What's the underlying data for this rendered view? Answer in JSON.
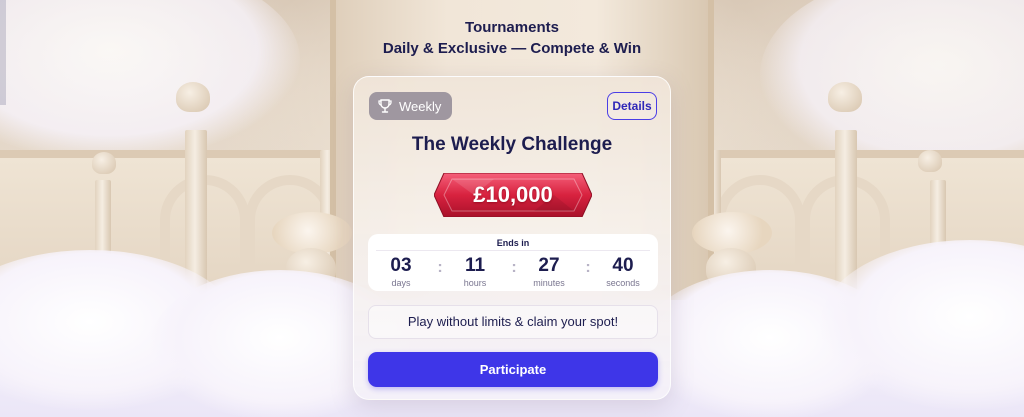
{
  "header": {
    "title": "Tournaments",
    "subtitle": "Daily & Exclusive — Compete & Win"
  },
  "card": {
    "badge": {
      "icon": "trophy-icon",
      "label": "Weekly"
    },
    "details_label": "Details",
    "title": "The Weekly Challenge",
    "prize": "£10,000",
    "countdown": {
      "heading": "Ends in",
      "units": [
        {
          "value": "03",
          "label": "days"
        },
        {
          "value": "11",
          "label": "hours"
        },
        {
          "value": "27",
          "label": "minutes"
        },
        {
          "value": "40",
          "label": "seconds"
        }
      ],
      "separator": ":"
    },
    "promo_text": "Play without limits & claim your spot!",
    "cta_label": "Participate"
  },
  "colors": {
    "accent": "#3e36e8",
    "text_dark": "#1d1d4f",
    "prize_red": "#d8223f",
    "badge_gray": "#9f97a0"
  }
}
